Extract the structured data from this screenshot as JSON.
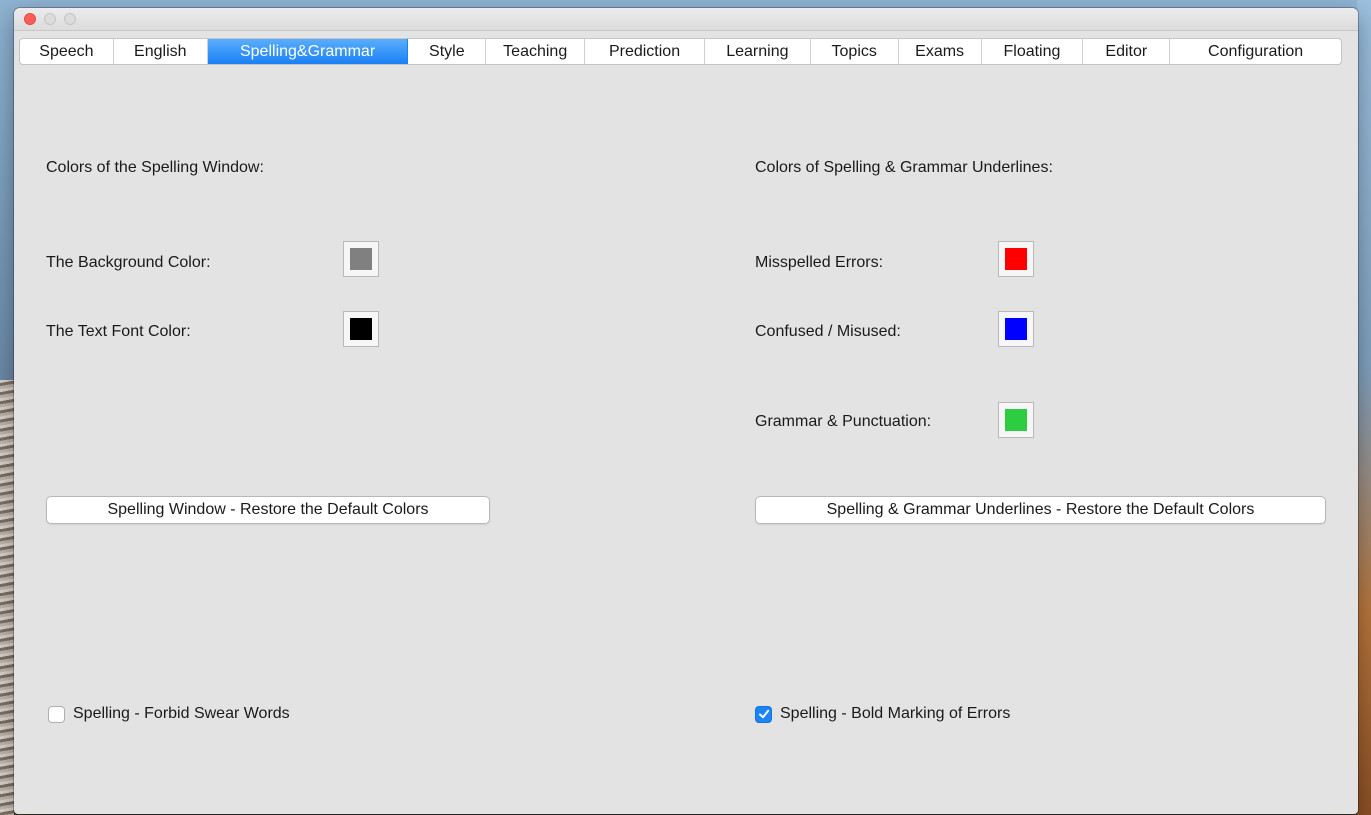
{
  "tabs": [
    {
      "label": "Speech"
    },
    {
      "label": "English"
    },
    {
      "label": "Spelling&Grammar",
      "active": true
    },
    {
      "label": "Style"
    },
    {
      "label": "Teaching"
    },
    {
      "label": "Prediction"
    },
    {
      "label": "Learning"
    },
    {
      "label": "Topics"
    },
    {
      "label": "Exams"
    },
    {
      "label": "Floating"
    },
    {
      "label": "Editor"
    },
    {
      "label": "Configuration"
    }
  ],
  "left": {
    "section_title": "Colors of the Spelling Window:",
    "background_label": "The Background Color:",
    "background_color": "#808080",
    "text_font_label": "The Text Font Color:",
    "text_font_color": "#000000",
    "restore_button": "Spelling Window - Restore the Default Colors",
    "checkbox_label": "Spelling - Forbid Swear Words",
    "checkbox_checked": false
  },
  "right": {
    "section_title": "Colors of Spelling & Grammar Underlines:",
    "misspelled_label": "Misspelled Errors:",
    "misspelled_color": "#ff0000",
    "confused_label": "Confused / Misused:",
    "confused_color": "#0000ff",
    "grammar_label": "Grammar & Punctuation:",
    "grammar_color": "#2ecc40",
    "restore_button": "Spelling & Grammar Underlines - Restore the Default Colors",
    "checkbox_label": "Spelling - Bold Marking of Errors",
    "checkbox_checked": true
  },
  "colors": {
    "accent": "#1a80f5",
    "window_bg": "#e3e3e3"
  }
}
